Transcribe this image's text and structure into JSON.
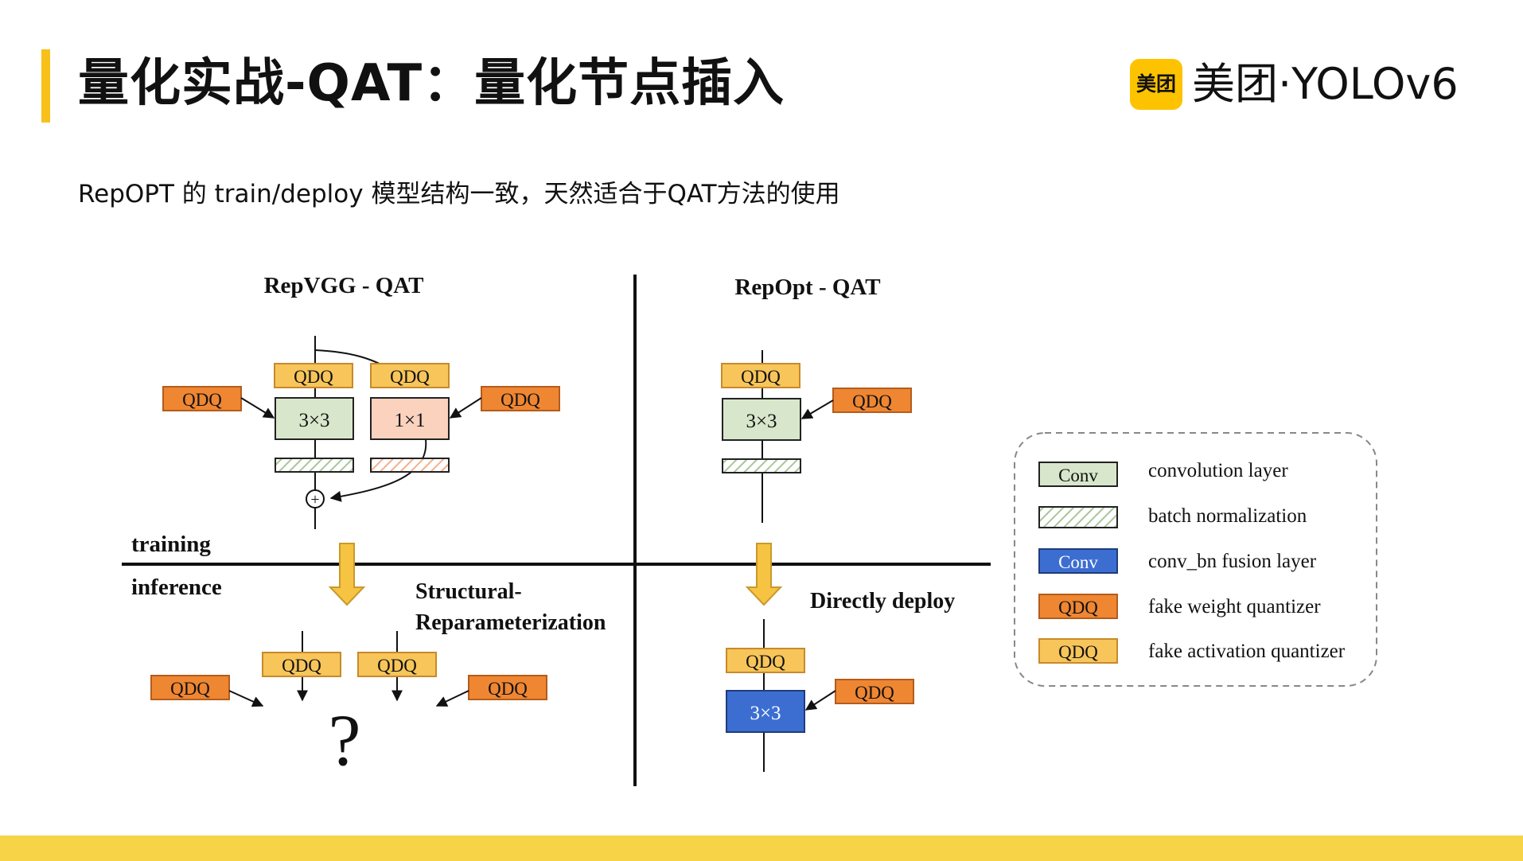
{
  "slide": {
    "title": "量化实战-QAT：量化节点插入",
    "subtitle": "RepOPT 的 train/deploy 模型结构一致，天然适合于QAT方法的使用",
    "brand": {
      "badge": "美团",
      "name": "美团·YOLOv6"
    },
    "accent_color": "#f7c11a"
  },
  "diagram": {
    "left_title": "RepVGG - QAT",
    "right_title": "RepOpt - QAT",
    "training_label": "training",
    "inference_label": "inference",
    "left_transition": [
      "Structural-",
      "Reparameterization"
    ],
    "right_transition": "Directly deploy",
    "qdq_label": "QDQ",
    "conv3_label": "3×3",
    "conv1_label": "1×1",
    "add_symbol": "+",
    "unknown_symbol": "?"
  },
  "legend": {
    "items": [
      {
        "swatch": "conv",
        "swatch_label": "Conv",
        "text": "convolution layer"
      },
      {
        "swatch": "bn",
        "swatch_label": "",
        "text": "batch normalization"
      },
      {
        "swatch": "fused",
        "swatch_label": "Conv",
        "text": "conv_bn fusion layer"
      },
      {
        "swatch": "weight",
        "swatch_label": "QDQ",
        "text": "fake weight quantizer"
      },
      {
        "swatch": "activation",
        "swatch_label": "QDQ",
        "text": "fake activation quantizer"
      }
    ]
  },
  "colors": {
    "conv": "#d8e7cc",
    "conv_1x1": "#fad2be",
    "fused_conv": "#3c6ed2",
    "weight_quantizer": "#ef8632",
    "activation_quantizer": "#f7c55a",
    "arrow_fill": "#f6c343"
  }
}
